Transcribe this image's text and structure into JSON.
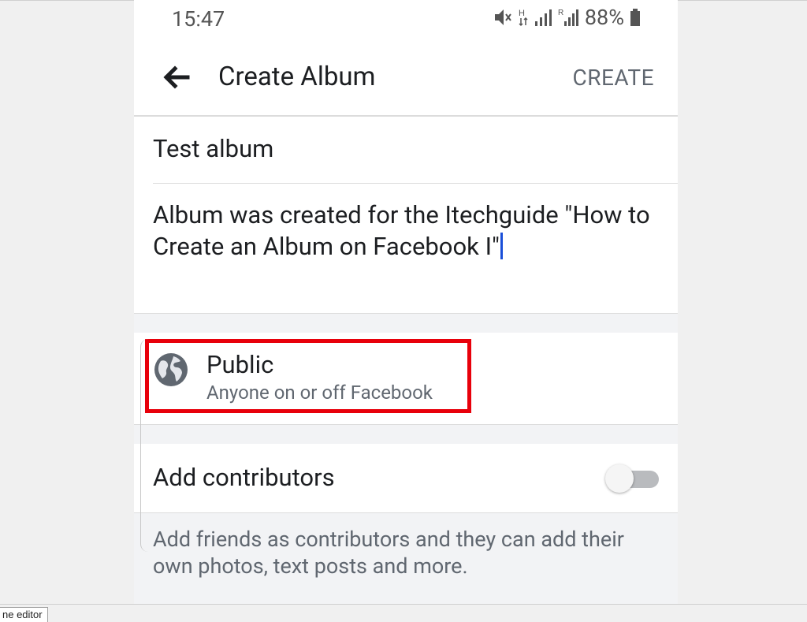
{
  "status_bar": {
    "time": "15:47",
    "battery": "88%",
    "icons": [
      "mute-icon",
      "h-plus-network-icon",
      "signal-icon",
      "roaming-signal-icon",
      "battery-icon"
    ]
  },
  "appbar": {
    "back_icon": "arrow-left-icon",
    "title": "Create Album",
    "create_label": "CREATE"
  },
  "form": {
    "album_name": "Test album",
    "description": "Album was created for the Itechguide \"How to Create an Album on Facebook I\""
  },
  "privacy": {
    "icon": "globe-icon",
    "title": "Public",
    "subtitle": "Anyone on or off Facebook",
    "highlight_color": "#e8000b"
  },
  "contributors": {
    "label": "Add contributors",
    "toggle_on": false,
    "help_text": "Add friends as contributors and they can add their own photos, text posts and more."
  },
  "taskbar": {
    "tab_label": "ne editor"
  },
  "colors": {
    "text_primary": "#1c1e21",
    "text_secondary": "#606770",
    "caret": "#1a4fd8"
  }
}
